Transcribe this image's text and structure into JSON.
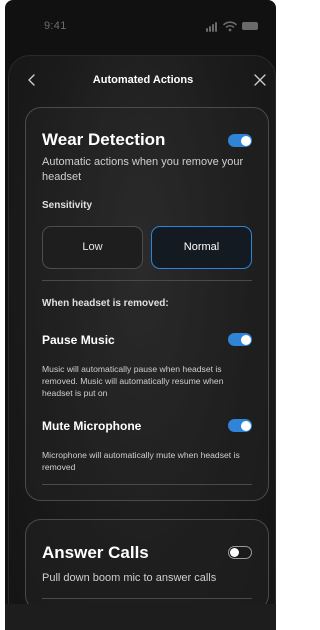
{
  "status_bar": {
    "time": "9:41",
    "icons": [
      "signal-icon",
      "wifi-icon",
      "battery-icon"
    ]
  },
  "header": {
    "title": "Automated Actions",
    "back_icon": "chevron-left-icon",
    "close_icon": "close-icon"
  },
  "wear_detection": {
    "title": "Wear Detection",
    "toggle_on": true,
    "description": "Automatic actions when you remove your headset",
    "sensitivity_label": "Sensitivity",
    "options": [
      "Low",
      "Normal"
    ],
    "selected": "Normal",
    "removed_label": "When headset is removed:",
    "pause_music": {
      "title": "Pause Music",
      "toggle_on": true,
      "description": "Music will automatically pause when headset is removed. Music will automatically resume when headset is put on"
    },
    "mute_microphone": {
      "title": "Mute Microphone",
      "toggle_on": true,
      "description": "Microphone will automatically mute when headset is removed"
    }
  },
  "answer_calls": {
    "title": "Answer Calls",
    "toggle_on": false,
    "description": "Pull down boom mic to answer calls"
  },
  "colors": {
    "accent": "#2f84d8",
    "background": "#111111",
    "card_border": "#4a4a4a"
  }
}
